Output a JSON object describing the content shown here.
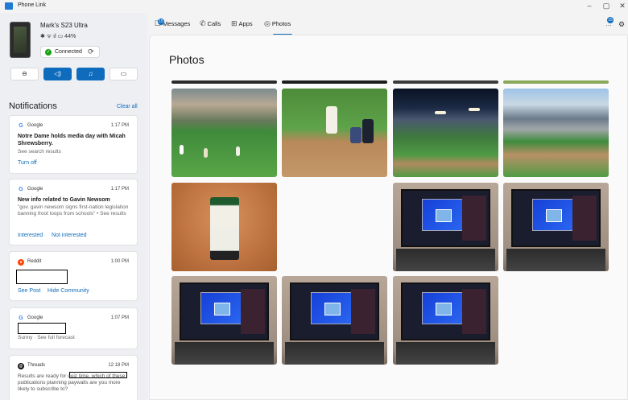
{
  "app": {
    "title": "Phone Link",
    "minimize": "–",
    "maximize": "▢",
    "close": "✕"
  },
  "device": {
    "name": "Mark's S23 Ultra",
    "status_icons": "✱ ᯤ ıl ▭",
    "battery": "44%",
    "connection": "Connected"
  },
  "controls": [
    {
      "name": "dnd-button",
      "glyph": "⊖",
      "on": false
    },
    {
      "name": "audio-button",
      "glyph": "◁)",
      "on": true
    },
    {
      "name": "music-button",
      "glyph": "♫",
      "on": true
    },
    {
      "name": "cast-button",
      "glyph": "▭",
      "on": false
    }
  ],
  "notifications": {
    "title": "Notifications",
    "clear_all": "Clear all",
    "items": [
      {
        "app": "Google",
        "time": "1:17 PM",
        "headline": "Notre Dame holds media day with Micah Shrewsberry.",
        "sub": "See search results",
        "actions": [
          "Turn off"
        ]
      },
      {
        "app": "Google",
        "time": "1:17 PM",
        "headline": "New info related to Gavin Newsom",
        "sub": "\"gov. gavin newsom signs first-nation legislation banning froot loops from schools\" • See results",
        "actions": [
          "Interested",
          "Not interested"
        ]
      },
      {
        "app": "Reddit",
        "time": "1:00 PM",
        "actions": [
          "See Post",
          "Hide Community"
        ]
      },
      {
        "app": "Google",
        "time": "1:07 PM",
        "sub": "Sunny · See full forecast"
      },
      {
        "app": "Threads",
        "time": "12:18 PM",
        "sub": "Results are ready for quiz time. which of these publications planning paywalls are you more likely to subscribe to?"
      }
    ]
  },
  "tabs": [
    {
      "label": "Messages",
      "icon": "chat-icon",
      "badge": "15"
    },
    {
      "label": "Calls",
      "icon": "phone-icon"
    },
    {
      "label": "Apps",
      "icon": "grid-icon"
    },
    {
      "label": "Photos",
      "icon": "photo-icon",
      "active": true
    }
  ],
  "header": {
    "bell_badge": "15"
  },
  "photos": {
    "title": "Photos",
    "grid": [
      [
        "stadium-crowd",
        "batter-at-plate",
        "night-stadium",
        "dusk-stadium"
      ],
      [
        "player-number-2",
        "",
        "laptop-screen",
        "laptop-screen"
      ],
      [
        "laptop-screen",
        "laptop-screen",
        "laptop-screen",
        ""
      ]
    ]
  },
  "colors": {
    "accent": "#0f6cbd",
    "connected": "#13a10e"
  }
}
